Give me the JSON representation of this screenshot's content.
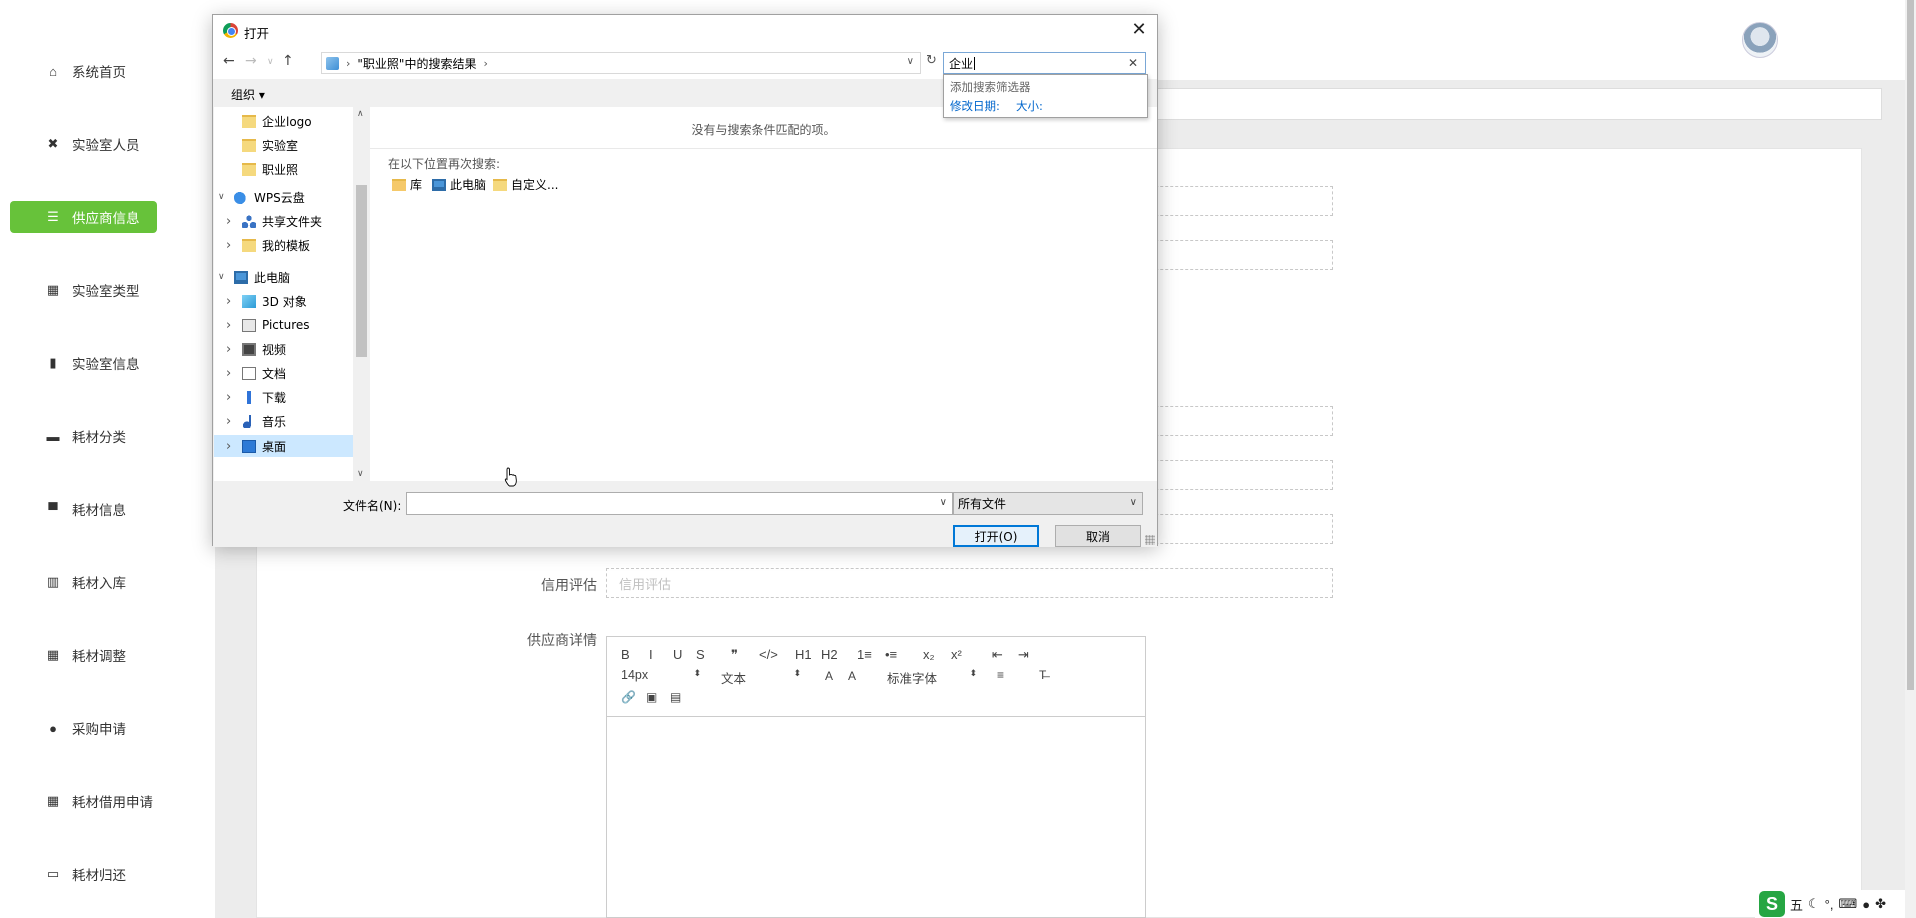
{
  "sidebar": {
    "items": [
      {
        "label": "系统首页",
        "icon": "home-icon",
        "glyph": "⌂"
      },
      {
        "label": "实验室人员",
        "icon": "people-icon",
        "glyph": "✖"
      },
      {
        "label": "供应商信息",
        "icon": "sliders-icon",
        "glyph": "☰",
        "active": true
      },
      {
        "label": "实验室类型",
        "icon": "grid-icon",
        "glyph": "▦"
      },
      {
        "label": "实验室信息",
        "icon": "bar-chart-icon",
        "glyph": "▮"
      },
      {
        "label": "耗材分类",
        "icon": "monitor-icon",
        "glyph": "▬"
      },
      {
        "label": "耗材信息",
        "icon": "stand-icon",
        "glyph": "▀"
      },
      {
        "label": "耗材入库",
        "icon": "library-icon",
        "glyph": "▥"
      },
      {
        "label": "耗材调整",
        "icon": "grid-icon",
        "glyph": "▦"
      },
      {
        "label": "采购申请",
        "icon": "person-icon",
        "glyph": "●"
      },
      {
        "label": "耗材借用申请",
        "icon": "grid-icon",
        "glyph": "▦"
      },
      {
        "label": "耗材归还",
        "icon": "briefcase-icon",
        "glyph": "▭"
      }
    ],
    "accent_color": "#67c23a"
  },
  "form": {
    "credit_label": "信用评估",
    "credit_placeholder": "信用评估",
    "detail_label": "供应商详情",
    "editor": {
      "font_size": "14px",
      "text_style": "文本",
      "font_family": "标准字体",
      "buttons_row1": [
        "B",
        "I",
        "U",
        "S",
        "❞",
        "</>",
        "H1",
        "H2",
        "1≡",
        "•≡",
        "x₂",
        "x²",
        "⇤",
        "⇥"
      ]
    }
  },
  "dialog": {
    "title": "打开",
    "address": "\"职业照\"中的搜索结果",
    "search_value": "企业",
    "search_dropdown": {
      "hint": "添加搜索筛选器",
      "filter_date": "修改日期:",
      "filter_size": "大小:"
    },
    "organize_label": "组织 ▾",
    "tree": [
      {
        "label": "企业logo",
        "icon": "folder",
        "indent": 2,
        "chevron": ""
      },
      {
        "label": "实验室",
        "icon": "folder",
        "indent": 2,
        "chevron": ""
      },
      {
        "label": "职业照",
        "icon": "folder",
        "indent": 2,
        "chevron": ""
      },
      {
        "label": "WPS云盘",
        "icon": "cloud",
        "indent": 1,
        "chevron": "v"
      },
      {
        "label": "共享文件夹",
        "icon": "share",
        "indent": 2,
        "chevron": ">"
      },
      {
        "label": "我的模板",
        "icon": "folder",
        "indent": 2,
        "chevron": ">"
      },
      {
        "label": "此电脑",
        "icon": "pc",
        "indent": 1,
        "chevron": "v"
      },
      {
        "label": "3D 对象",
        "icon": "3d",
        "indent": 2,
        "chevron": ">"
      },
      {
        "label": "Pictures",
        "icon": "pic",
        "indent": 2,
        "chevron": ">"
      },
      {
        "label": "视频",
        "icon": "video",
        "indent": 2,
        "chevron": ">"
      },
      {
        "label": "文档",
        "icon": "doc",
        "indent": 2,
        "chevron": ">"
      },
      {
        "label": "下载",
        "icon": "down",
        "indent": 2,
        "chevron": ">"
      },
      {
        "label": "音乐",
        "icon": "music",
        "indent": 2,
        "chevron": ">"
      },
      {
        "label": "桌面",
        "icon": "desktop",
        "indent": 2,
        "chevron": ">",
        "selected": true
      }
    ],
    "no_results": "没有与搜索条件匹配的项。",
    "search_again_label": "在以下位置再次搜索:",
    "search_locations": [
      {
        "label": "库",
        "icon": "library-folder-icon"
      },
      {
        "label": "此电脑",
        "icon": "computer-icon"
      },
      {
        "label": "自定义...",
        "icon": "custom-folder-icon"
      }
    ],
    "filename_label": "文件名(N):",
    "filename_value": "",
    "filetype_value": "所有文件",
    "open_label": "打开(O)",
    "cancel_label": "取消"
  },
  "ime": {
    "mode": "五",
    "punct": "°,"
  }
}
